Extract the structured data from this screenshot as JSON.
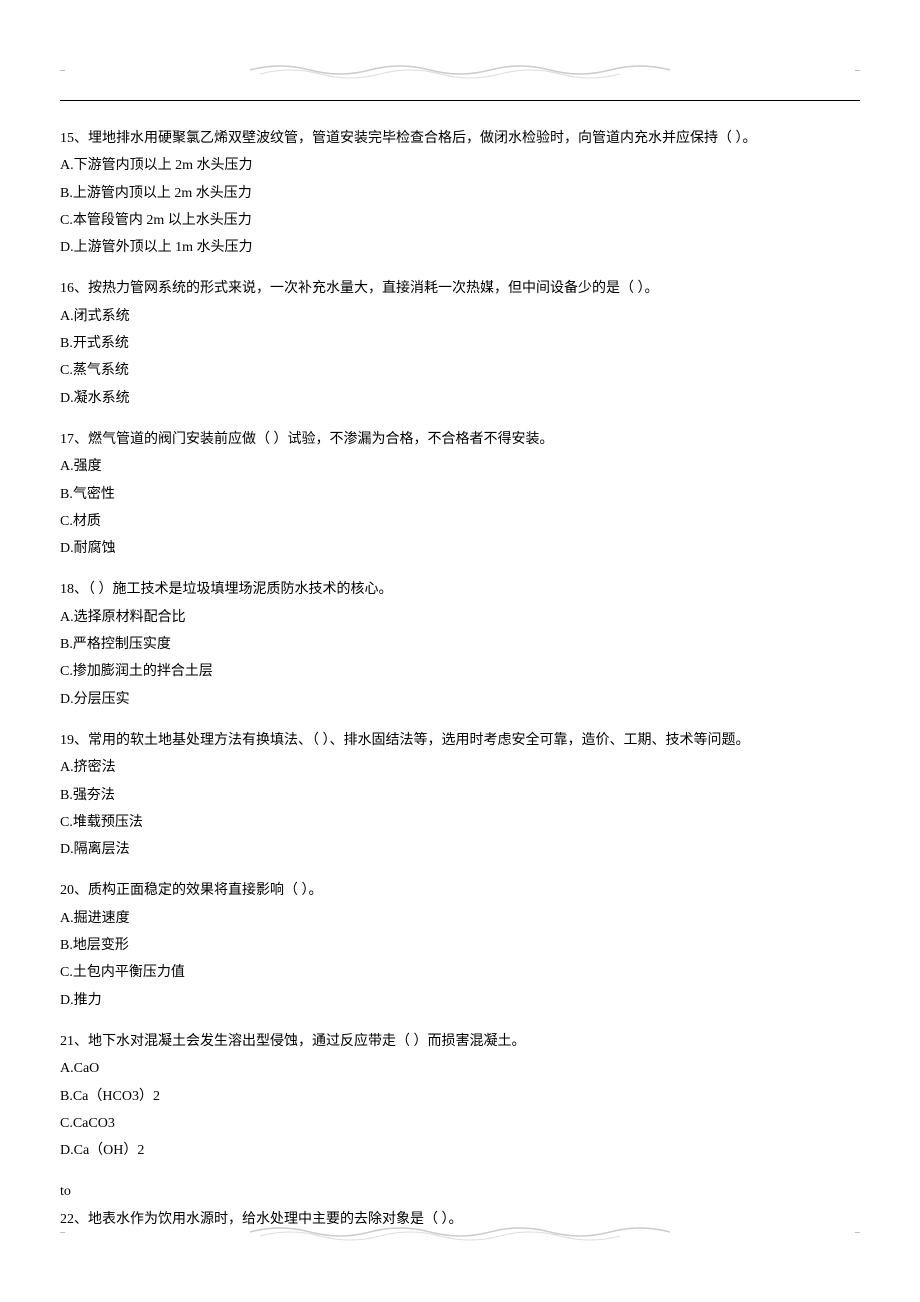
{
  "questions": [
    {
      "stem": "15、埋地排水用硬聚氯乙烯双壁波纹管，管道安装完毕检查合格后，做闭水检验时，向管道内充水并应保持（  ）。",
      "options": [
        "A.下游管内顶以上 2m 水头压力",
        "B.上游管内顶以上 2m 水头压力",
        "C.本管段管内 2m 以上水头压力",
        "D.上游管外顶以上 1m 水头压力"
      ]
    },
    {
      "stem": "16、按热力管网系统的形式来说，一次补充水量大，直接消耗一次热媒，但中间设备少的是（  ）。",
      "options": [
        "A.闭式系统",
        "B.开式系统",
        "C.蒸气系统",
        "D.凝水系统"
      ]
    },
    {
      "stem": "17、燃气管道的阀门安装前应做（  ）试验，不渗漏为合格，不合格者不得安装。",
      "options": [
        "A.强度",
        "B.气密性",
        "C.材质",
        "D.耐腐蚀"
      ]
    },
    {
      "stem": "18、（  ）施工技术是垃圾填埋场泥质防水技术的核心。",
      "options": [
        "A.选择原材料配合比",
        "B.严格控制压实度",
        "C.掺加膨润土的拌合土层",
        "D.分层压实"
      ]
    },
    {
      "stem": "19、常用的软土地基处理方法有换填法、（  ）、排水固结法等，选用时考虑安全可靠，造价、工期、技术等问题。",
      "options": [
        "A.挤密法",
        "B.强夯法",
        "C.堆载预压法",
        "D.隔离层法"
      ]
    },
    {
      "stem": "20、质构正面稳定的效果将直接影响（  ）。",
      "options": [
        "A.掘进速度",
        "B.地层变形",
        "C.土包内平衡压力值",
        "D.推力"
      ]
    },
    {
      "stem": "21、地下水对混凝土会发生溶出型侵蚀，通过反应带走（  ）而损害混凝土。",
      "options": [
        "A.CaO",
        "B.Ca（HCO3）2",
        "C.CaCO3",
        "D.Ca（OH）2"
      ]
    },
    {
      "stem": "22、地表水作为饮用水源时，给水处理中主要的去除对象是（  ）。",
      "options": []
    }
  ]
}
